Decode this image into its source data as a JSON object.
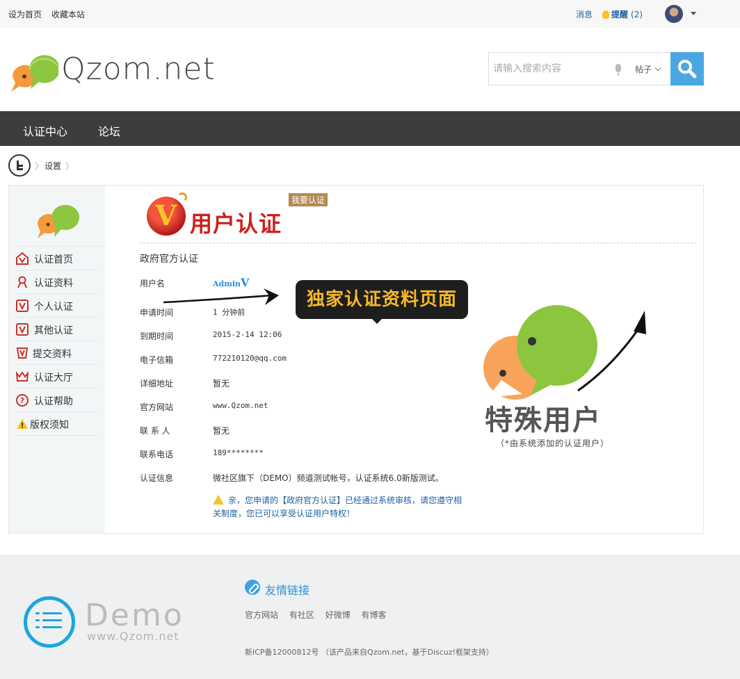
{
  "topbar": {
    "set_home": "设为首页",
    "bookmark": "收藏本站",
    "messages": "消息",
    "remind": "提醒",
    "remind_count": "(2)"
  },
  "header": {
    "logo_text": "Qzom.net",
    "search_placeholder": "请输入搜索内容",
    "search_type": "帖子"
  },
  "nav": {
    "items": [
      {
        "label": "认证中心"
      },
      {
        "label": "论坛"
      }
    ]
  },
  "breadcrumb": {
    "current": "设置",
    "sep": "〉"
  },
  "sidebar": {
    "items": [
      {
        "label": "认证首页",
        "icon": "home-v-icon"
      },
      {
        "label": "认证资料",
        "icon": "user-icon"
      },
      {
        "label": "个人认证",
        "icon": "v-badge-icon"
      },
      {
        "label": "其他认证",
        "icon": "v-badge-icon"
      },
      {
        "label": "提交资料",
        "icon": "v-check-icon"
      },
      {
        "label": "认证大厅",
        "icon": "crown-icon"
      },
      {
        "label": "认证帮助",
        "icon": "help-icon"
      },
      {
        "label": "版权须知",
        "icon": "warning-icon"
      }
    ]
  },
  "content": {
    "banner_title": "用户认证",
    "banner_tag": "我要认证",
    "section_title": "政府官方认证",
    "username_label": "用户名",
    "username_value": "Admin",
    "callout": "独家认证资料页面",
    "rows": [
      {
        "label": "申请时间",
        "value": "1 分钟前"
      },
      {
        "label": "到期时间",
        "value": "2015-2-14 12:06"
      },
      {
        "label": "电子信箱",
        "value": "772210120@qq.com"
      },
      {
        "label": "详细地址",
        "value": "暂无"
      },
      {
        "label": "官方网站",
        "value": "www.Qzom.net"
      },
      {
        "label": "联 系 人",
        "value": "暂无"
      },
      {
        "label": "联系电话",
        "value": "189********"
      },
      {
        "label": "认证信息",
        "value": "微社区旗下（DEMO）频道测试帐号，认证系统6.0新版测试。"
      }
    ],
    "notice_line1": "亲，您申请的【政府官方认证】已经通过系统审核，请您遵守相",
    "notice_line2": "关制度，您已可以享受认证用户特权！",
    "special_title": "特殊用户",
    "special_sub": "（*由系统添加的认证用户）"
  },
  "footer": {
    "demo_text": "Demo",
    "site_text": "www.Qzom.net",
    "links_title": "友情链接",
    "links": [
      "官方网站",
      "有社区",
      "好微博",
      "有博客"
    ],
    "copyright": "新ICP备12000812号 （该产品来自Qzom.net，基于Discuz!框架支持）"
  },
  "colors": {
    "nav_bg": "#3d3d3d",
    "search_btn": "#4aa7e2",
    "link_blue": "#1f5fa0",
    "callout_text": "#f6b929",
    "banner_red": "#d01d1d"
  }
}
